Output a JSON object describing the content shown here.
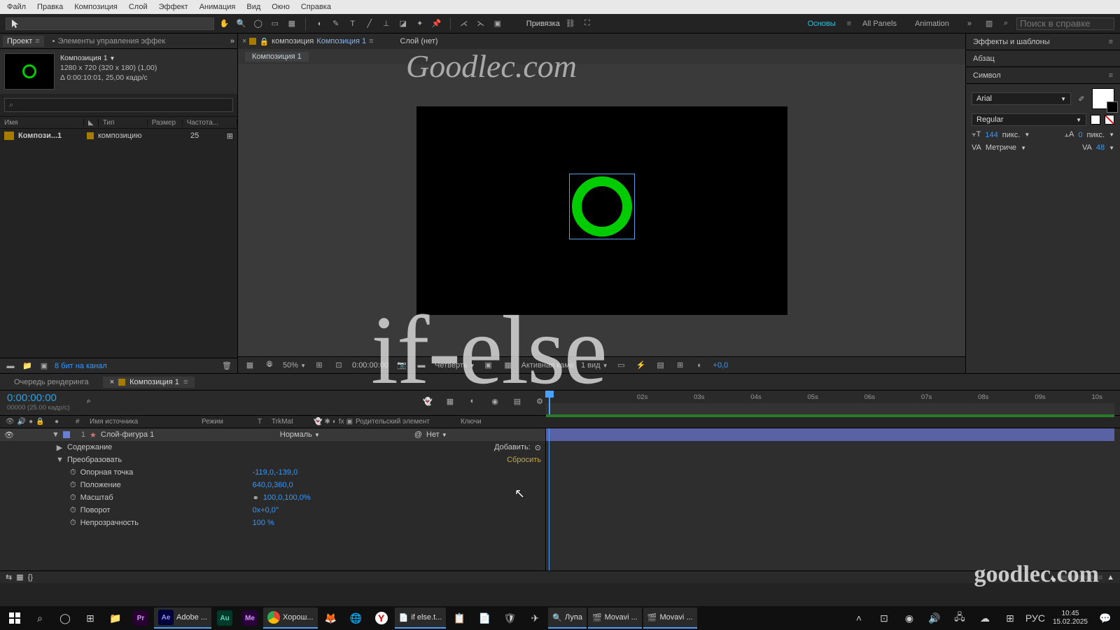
{
  "menu": [
    "Файл",
    "Правка",
    "Композиция",
    "Слой",
    "Эффект",
    "Анимация",
    "Вид",
    "Окно",
    "Справка"
  ],
  "toolbar": {
    "snap": "Привязка"
  },
  "workspaces": {
    "a": "Основы",
    "b": "All Panels",
    "c": "Animation"
  },
  "search": {
    "ph": "Поиск в справке"
  },
  "project": {
    "tab": "Проект",
    "tab2": "Элементы управления эффек",
    "comp_name": "Композиция 1",
    "info1": "1280 x 720  (320 x 180) (1,00)",
    "info2": "Δ 0:00:10:01, 25,00 кадр/с",
    "search_ph": "⌕",
    "cols": {
      "name": "Имя",
      "type": "Тип",
      "size": "Размер",
      "rate": "Частота..."
    },
    "row": {
      "name": "Компози...1",
      "type": "композицию",
      "rate": "25"
    },
    "footer": "8 бит на канал"
  },
  "comp": {
    "crumb_prefix": "композиция",
    "crumb": "Композиция 1",
    "tab_layer": "Слой (нет)",
    "sub": "Композиция 1"
  },
  "viewer": {
    "zoom": "50%",
    "time": "0:00:00:00",
    "res": "Четверть",
    "cam": "Активная каме",
    "views": "1 вид",
    "exp": "+0,0"
  },
  "right": {
    "effects": "Эффекты и шаблоны",
    "para": "Абзац",
    "char": "Символ",
    "font": "Arial",
    "style": "Regular",
    "size": "144",
    "size_u": "пикс.",
    "track": "0",
    "track_u": "пикс.",
    "lead": "48",
    "lead_lbl": "Метриче"
  },
  "timeline": {
    "tab_render": "Очередь рендеринга",
    "tab_comp": "Композиция 1",
    "time": "0:00:00:00",
    "sub": "00000 (25.00 кадр/с)",
    "cols": {
      "num": "#",
      "src": "Имя источника",
      "mode": "Режим",
      "t": "T",
      "trk": "TrkMat",
      "parent": "Родительский элемент",
      "keys": "Ключи"
    },
    "ticks": [
      "02s",
      "03s",
      "04s",
      "05s",
      "06s",
      "07s",
      "08s",
      "09s",
      "10s"
    ],
    "layer": {
      "idx": "1",
      "name": "Слой-фигура 1",
      "mode": "Нормаль",
      "trkmat": "Нет",
      "contents": "Содержание",
      "add": "Добавить:",
      "transform": "Преобразовать",
      "reset": "Сбросить",
      "anchor": "Опорная точка",
      "anchor_v": "-119,0,-139,0",
      "pos": "Положение",
      "pos_v": "640,0,360,0",
      "scale": "Масштаб",
      "scale_v": "100,0,100,0%",
      "rot": "Поворот",
      "rot_v": "0x+0,0°",
      "opac": "Непрозрачность",
      "opac_v": "100 %"
    }
  },
  "marks": {
    "w1": "Goodlec.com",
    "w2": "if-else",
    "w3": "goodlec.com"
  },
  "taskbar": {
    "adobe": "Adobe ...",
    "chrome": "Хорош...",
    "ifelse": "if else.t...",
    "lupa": "Лупа",
    "movavi1": "Movavi ...",
    "movavi2": "Movavi ...",
    "lang": "РУС",
    "time": "10:45",
    "date": "15.02.2025"
  }
}
